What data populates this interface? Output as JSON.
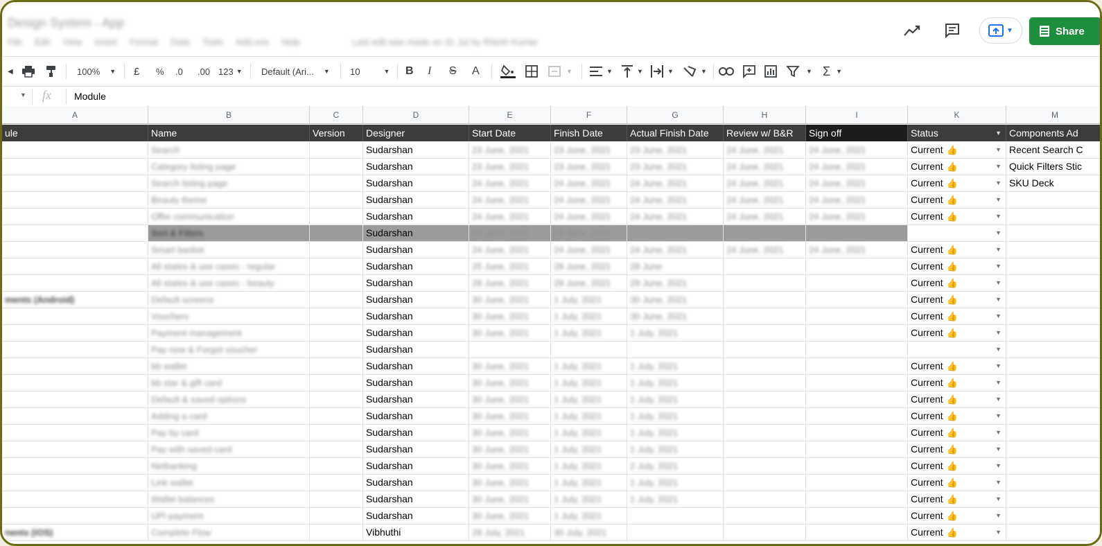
{
  "header": {
    "doc_title": "Design System - App",
    "menu": [
      "File",
      "Edit",
      "View",
      "Insert",
      "Format",
      "Data",
      "Tools",
      "Add-ons",
      "Help"
    ],
    "last_edit": "Last edit was made on 31 Jul by Ritesh Kumar",
    "share_label": "Share"
  },
  "toolbar": {
    "zoom": "100%",
    "currency": "£",
    "percent": "%",
    "dec_less": ".0",
    "dec_more": ".00",
    "format": "123",
    "font": "Default (Ari...",
    "font_size": "10"
  },
  "formula": {
    "fx": "fx",
    "value": "Module"
  },
  "columns": [
    "A",
    "B",
    "C",
    "D",
    "E",
    "F",
    "G",
    "H",
    "I",
    "K",
    "M"
  ],
  "table_headers": [
    "ule",
    "Name",
    "Version",
    "Designer",
    "Start Date",
    "Finish Date",
    "Actual Finish Date",
    "Review w/ B&R",
    "Sign off",
    "Status",
    "Components Ad"
  ],
  "rows": [
    {
      "a": "",
      "name": "Search",
      "designer": "Sudarshan",
      "start": "23 June, 2021",
      "finish": "23 June, 2021",
      "actual": "23 June, 2021",
      "review": "24 June, 2021",
      "signoff": "24 June, 2021",
      "status": "Current",
      "comp": "Recent Search C"
    },
    {
      "a": "",
      "name": "Category listing page",
      "designer": "Sudarshan",
      "start": "23 June, 2021",
      "finish": "23 June, 2021",
      "actual": "23 June, 2021",
      "review": "24 June, 2021",
      "signoff": "24 June, 2021",
      "status": "Current",
      "comp": "Quick Filters Stic"
    },
    {
      "a": "",
      "name": "Search listing page",
      "designer": "Sudarshan",
      "start": "24 June, 2021",
      "finish": "24 June, 2021",
      "actual": "24 June, 2021",
      "review": "24 June, 2021",
      "signoff": "24 June, 2021",
      "status": "Current",
      "comp": "SKU Deck"
    },
    {
      "a": "",
      "name": "Beauty theme",
      "designer": "Sudarshan",
      "start": "24 June, 2021",
      "finish": "24 June, 2021",
      "actual": "24 June, 2021",
      "review": "24 June, 2021",
      "signoff": "24 June, 2021",
      "status": "Current",
      "comp": ""
    },
    {
      "a": "",
      "name": "Offer communication",
      "designer": "Sudarshan",
      "start": "24 June, 2021",
      "finish": "24 June, 2021",
      "actual": "24 June, 2021",
      "review": "24 June, 2021",
      "signoff": "24 June, 2021",
      "status": "Current",
      "comp": ""
    },
    {
      "a": "",
      "name": "Sort & Filters",
      "designer": "Sudarshan",
      "start": "24 June, 2021",
      "finish": "24 June, 2021",
      "actual": "",
      "review": "",
      "signoff": "",
      "status": "",
      "comp": "",
      "highlight": true
    },
    {
      "a": "",
      "name": "Smart basket",
      "designer": "Sudarshan",
      "start": "24 June, 2021",
      "finish": "24 June, 2021",
      "actual": "24 June, 2021",
      "review": "24 June, 2021",
      "signoff": "24 June, 2021",
      "status": "Current",
      "comp": ""
    },
    {
      "a": "",
      "name": "All states & use cases - regular",
      "designer": "Sudarshan",
      "start": "25 June, 2021",
      "finish": "28 June, 2021",
      "actual": "28 June",
      "review": "",
      "signoff": "",
      "status": "Current",
      "comp": ""
    },
    {
      "a": "",
      "name": "All states & use cases - beauty",
      "designer": "Sudarshan",
      "start": "28 June, 2021",
      "finish": "29 June, 2021",
      "actual": "29 June, 2021",
      "review": "",
      "signoff": "",
      "status": "Current",
      "comp": ""
    },
    {
      "a": "ments (Android)",
      "name": "Default screens",
      "designer": "Sudarshan",
      "start": "30 June, 2021",
      "finish": "1 July, 2021",
      "actual": "30 June, 2021",
      "review": "",
      "signoff": "",
      "status": "Current",
      "comp": ""
    },
    {
      "a": "",
      "name": "Vouchers",
      "designer": "Sudarshan",
      "start": "30 June, 2021",
      "finish": "1 July, 2021",
      "actual": "30 June, 2021",
      "review": "",
      "signoff": "",
      "status": "Current",
      "comp": ""
    },
    {
      "a": "",
      "name": "Payment management",
      "designer": "Sudarshan",
      "start": "30 June, 2021",
      "finish": "1 July, 2021",
      "actual": "1 July, 2021",
      "review": "",
      "signoff": "",
      "status": "Current",
      "comp": ""
    },
    {
      "a": "",
      "name": "Pay now & Forgot voucher",
      "designer": "Sudarshan",
      "start": "",
      "finish": "",
      "actual": "",
      "review": "",
      "signoff": "",
      "status": "",
      "comp": ""
    },
    {
      "a": "",
      "name": "bb wallet",
      "designer": "Sudarshan",
      "start": "30 June, 2021",
      "finish": "1 July, 2021",
      "actual": "1 July, 2021",
      "review": "",
      "signoff": "",
      "status": "Current",
      "comp": ""
    },
    {
      "a": "",
      "name": "bb star & gift card",
      "designer": "Sudarshan",
      "start": "30 June, 2021",
      "finish": "1 July, 2021",
      "actual": "1 July, 2021",
      "review": "",
      "signoff": "",
      "status": "Current",
      "comp": ""
    },
    {
      "a": "",
      "name": "Default & saved options",
      "designer": "Sudarshan",
      "start": "30 June, 2021",
      "finish": "1 July, 2021",
      "actual": "1 July, 2021",
      "review": "",
      "signoff": "",
      "status": "Current",
      "comp": ""
    },
    {
      "a": "",
      "name": "Adding a card",
      "designer": "Sudarshan",
      "start": "30 June, 2021",
      "finish": "1 July, 2021",
      "actual": "1 July, 2021",
      "review": "",
      "signoff": "",
      "status": "Current",
      "comp": ""
    },
    {
      "a": "",
      "name": "Pay by card",
      "designer": "Sudarshan",
      "start": "30 June, 2021",
      "finish": "1 July, 2021",
      "actual": "1 July, 2021",
      "review": "",
      "signoff": "",
      "status": "Current",
      "comp": ""
    },
    {
      "a": "",
      "name": "Pay with saved card",
      "designer": "Sudarshan",
      "start": "30 June, 2021",
      "finish": "1 July, 2021",
      "actual": "1 July, 2021",
      "review": "",
      "signoff": "",
      "status": "Current",
      "comp": ""
    },
    {
      "a": "",
      "name": "Netbanking",
      "designer": "Sudarshan",
      "start": "30 June, 2021",
      "finish": "1 July, 2021",
      "actual": "2 July, 2021",
      "review": "",
      "signoff": "",
      "status": "Current",
      "comp": ""
    },
    {
      "a": "",
      "name": "Link wallet",
      "designer": "Sudarshan",
      "start": "30 June, 2021",
      "finish": "1 July, 2021",
      "actual": "1 July, 2021",
      "review": "",
      "signoff": "",
      "status": "Current",
      "comp": ""
    },
    {
      "a": "",
      "name": "Wallet balances",
      "designer": "Sudarshan",
      "start": "30 June, 2021",
      "finish": "1 July, 2021",
      "actual": "1 July, 2021",
      "review": "",
      "signoff": "",
      "status": "Current",
      "comp": ""
    },
    {
      "a": "",
      "name": "UPI payment",
      "designer": "Sudarshan",
      "start": "30 June, 2021",
      "finish": "1 July, 2021",
      "actual": "",
      "review": "",
      "signoff": "",
      "status": "Current",
      "comp": ""
    },
    {
      "a": "nents (iOS)",
      "name": "Complete Flow",
      "designer": "Vibhuthi",
      "start": "28 July, 2021",
      "finish": "30 July, 2021",
      "actual": "",
      "review": "",
      "signoff": "",
      "status": "Current",
      "comp": ""
    }
  ]
}
